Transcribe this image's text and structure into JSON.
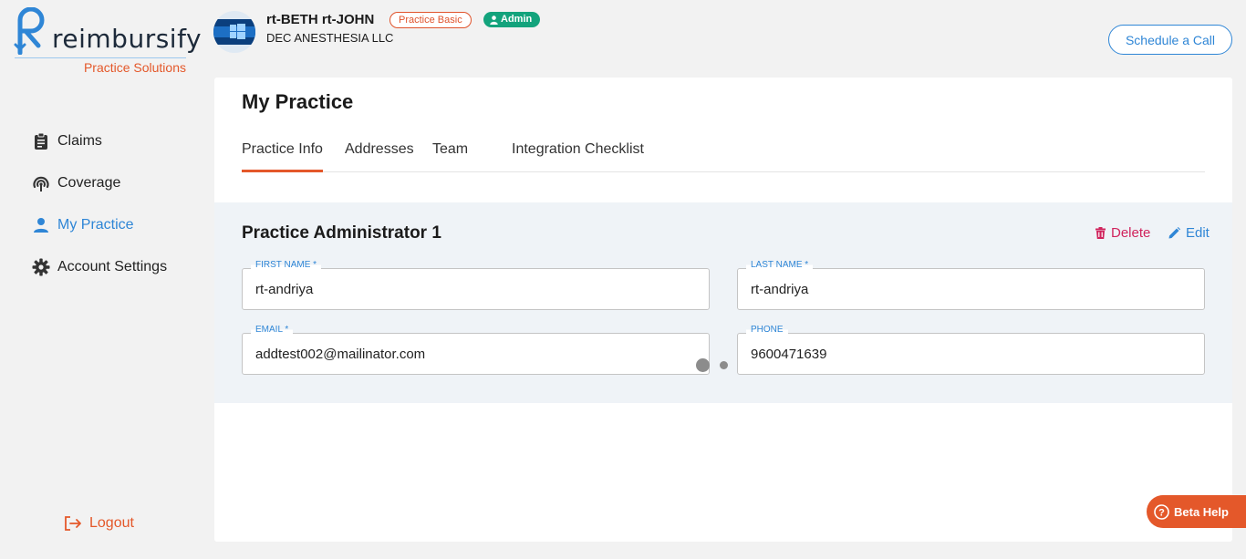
{
  "brand": {
    "name": "reimbursify",
    "subtitle": "Practice Solutions"
  },
  "sidebar": {
    "items": [
      {
        "label": "Claims",
        "icon": "clipboard-icon",
        "active": false
      },
      {
        "label": "Coverage",
        "icon": "coverage-icon",
        "active": false
      },
      {
        "label": "My Practice",
        "icon": "person-icon",
        "active": true
      },
      {
        "label": "Account Settings",
        "icon": "gear-icon",
        "active": false
      }
    ],
    "logout_label": "Logout"
  },
  "header": {
    "user_name": "rt-BETH rt-JOHN",
    "org_name": "DEC ANESTHESIA LLC",
    "plan_badge": "Practice Basic",
    "role_badge": "Admin",
    "schedule_label": "Schedule a Call"
  },
  "main": {
    "title": "My Practice",
    "tabs": [
      {
        "label": "Practice Info",
        "active": true
      },
      {
        "label": "Addresses",
        "active": false
      },
      {
        "label": "Team",
        "active": false
      },
      {
        "label": "Integration Checklist",
        "active": false
      }
    ],
    "section": {
      "title": "Practice Administrator 1",
      "delete_label": "Delete",
      "edit_label": "Edit",
      "fields": {
        "first_name": {
          "label": "FIRST NAME *",
          "value": "rt-andriya"
        },
        "last_name": {
          "label": "LAST NAME *",
          "value": "rt-andriya"
        },
        "email": {
          "label": "EMAIL *",
          "value": "addtest002@mailinator.com"
        },
        "phone": {
          "label": "PHONE",
          "value": "9600471639"
        }
      }
    }
  },
  "beta_help": {
    "label": "Beta Help"
  },
  "colors": {
    "accent_blue": "#2f86d6",
    "accent_orange": "#e4582a",
    "admin_green": "#13a37c",
    "delete_red": "#d0245d"
  }
}
